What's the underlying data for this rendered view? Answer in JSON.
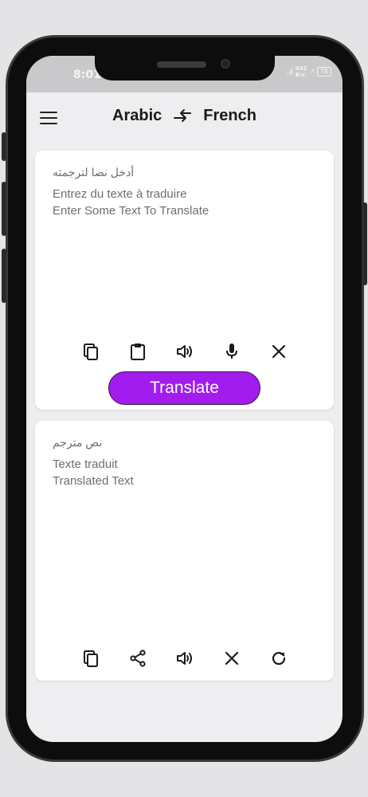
{
  "status_bar": {
    "time": "8:01",
    "signal": "..ıl",
    "net_speed_value": "442",
    "net_speed_unit": "B/s",
    "battery": "78"
  },
  "header": {
    "source_language": "Arabic",
    "target_language": "French"
  },
  "input_card": {
    "placeholder_arabic": "أدخل نصا لترجمته",
    "placeholder_french": "Entrez du texte à traduire",
    "placeholder_english": "Enter Some Text To Translate",
    "translate_label": "Translate"
  },
  "output_card": {
    "label_arabic": "نص مترجم",
    "label_french": "Texte traduit",
    "label_english": "Translated Text"
  },
  "colors": {
    "accent": "#a21ded",
    "screen_bg": "#eeeef0",
    "card_bg": "#ffffff",
    "icon": "#1a1a1a"
  },
  "icons": {
    "input_toolbar": [
      "copy-icon",
      "paste-icon",
      "speaker-icon",
      "mic-icon",
      "close-icon"
    ],
    "output_toolbar": [
      "copy-icon",
      "share-icon",
      "speaker-icon",
      "close-icon",
      "refresh-icon"
    ]
  }
}
